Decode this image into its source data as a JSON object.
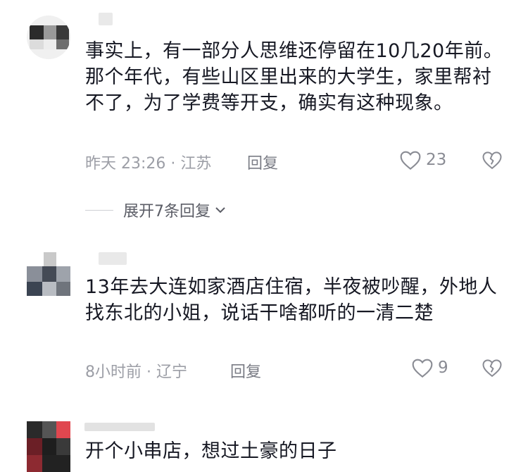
{
  "comments": [
    {
      "text": "事实上，有一部分人思维还停留在10几20年前。那个年代，有些山区里出来的大学生，家里帮衬不了，为了学费等开支，确实有这种现象。",
      "time_location": "昨天 23:26 · 江苏",
      "reply_label": "回复",
      "likes": "23",
      "expand_label": "展开7条回复"
    },
    {
      "text": "13年去大连如家酒店住宿，半夜被吵醒，外地人找东北的小姐，说话干啥都听的一清二楚",
      "time_location": "8小时前 · 辽宁",
      "reply_label": "回复",
      "likes": "9"
    },
    {
      "text": "开个小串店，想过土豪的日子"
    }
  ],
  "icons": {
    "like": "heart-outline-icon",
    "dislike": "broken-heart-icon",
    "expand": "chevron-down-icon"
  },
  "colors": {
    "text": "#161823",
    "meta": "#9c9ea6",
    "icon": "#8a8c94"
  }
}
